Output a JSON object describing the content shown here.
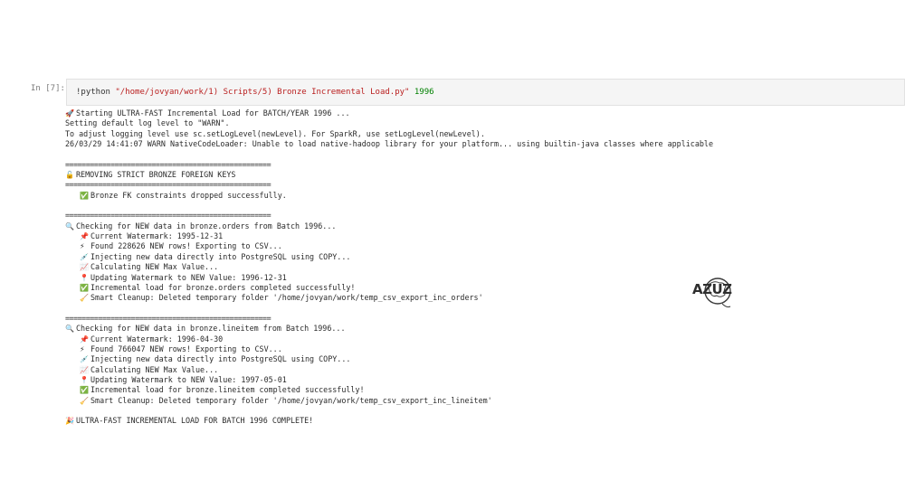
{
  "cell": {
    "prompt": "In [7]:",
    "cmd": "!python ",
    "path": "\"/home/jovyan/work/1) Scripts/5) Bronze Incremental Load.py\"",
    "arg": " 1996"
  },
  "output": [
    {
      "icon": "🚀",
      "text": "Starting ULTRA-FAST Incremental Load for BATCH/YEAR 1996 ...",
      "indent": false
    },
    {
      "icon": "",
      "text": "Setting default log level to \"WARN\".",
      "indent": false
    },
    {
      "icon": "",
      "text": "To adjust logging level use sc.setLogLevel(newLevel). For SparkR, use setLogLevel(newLevel).",
      "indent": false
    },
    {
      "icon": "",
      "text": "26/03/29 14:41:07 WARN NativeCodeLoader: Unable to load native-hadoop library for your platform... using builtin-java classes where applicable",
      "indent": false
    },
    {
      "blank": true
    },
    {
      "icon": "",
      "text": "==================================================",
      "indent": false,
      "sep": true
    },
    {
      "icon": "🔓",
      "text": "REMOVING STRICT BRONZE FOREIGN KEYS",
      "indent": false
    },
    {
      "icon": "",
      "text": "==================================================",
      "indent": false,
      "sep": true
    },
    {
      "icon": "✅",
      "text": "Bronze FK constraints dropped successfully.",
      "indent": true
    },
    {
      "blank": true
    },
    {
      "icon": "",
      "text": "==================================================",
      "indent": false,
      "sep": true
    },
    {
      "icon": "🔍",
      "text": "Checking for NEW data in bronze.orders from Batch 1996...",
      "indent": false
    },
    {
      "icon": "📌",
      "text": "Current Watermark: 1995-12-31",
      "indent": true
    },
    {
      "icon": "⚡",
      "text": "Found 228626 NEW rows! Exporting to CSV...",
      "indent": true
    },
    {
      "icon": "💉",
      "text": "Injecting new data directly into PostgreSQL using COPY...",
      "indent": true
    },
    {
      "icon": "📈",
      "text": "Calculating NEW Max Value...",
      "indent": true
    },
    {
      "icon": "📍",
      "text": "Updating Watermark to NEW Value: 1996-12-31",
      "indent": true
    },
    {
      "icon": "✅",
      "text": "Incremental load for bronze.orders completed successfully!",
      "indent": true
    },
    {
      "icon": "🧹",
      "text": "Smart Cleanup: Deleted temporary folder '/home/jovyan/work/temp_csv_export_inc_orders'",
      "indent": true
    },
    {
      "blank": true
    },
    {
      "icon": "",
      "text": "==================================================",
      "indent": false,
      "sep": true
    },
    {
      "icon": "🔍",
      "text": "Checking for NEW data in bronze.lineitem from Batch 1996...",
      "indent": false
    },
    {
      "icon": "📌",
      "text": "Current Watermark: 1996-04-30",
      "indent": true
    },
    {
      "icon": "⚡",
      "text": "Found 766047 NEW rows! Exporting to CSV...",
      "indent": true
    },
    {
      "icon": "💉",
      "text": "Injecting new data directly into PostgreSQL using COPY...",
      "indent": true
    },
    {
      "icon": "📈",
      "text": "Calculating NEW Max Value...",
      "indent": true
    },
    {
      "icon": "📍",
      "text": "Updating Watermark to NEW Value: 1997-05-01",
      "indent": true
    },
    {
      "icon": "✅",
      "text": "Incremental load for bronze.lineitem completed successfully!",
      "indent": true
    },
    {
      "icon": "🧹",
      "text": "Smart Cleanup: Deleted temporary folder '/home/jovyan/work/temp_csv_export_inc_lineitem'",
      "indent": true
    },
    {
      "blank": true
    },
    {
      "icon": "🎉",
      "text": "ULTRA-FAST INCREMENTAL LOAD FOR BATCH 1996 COMPLETE!",
      "indent": false
    }
  ],
  "logo": {
    "text": "AZUZ"
  }
}
